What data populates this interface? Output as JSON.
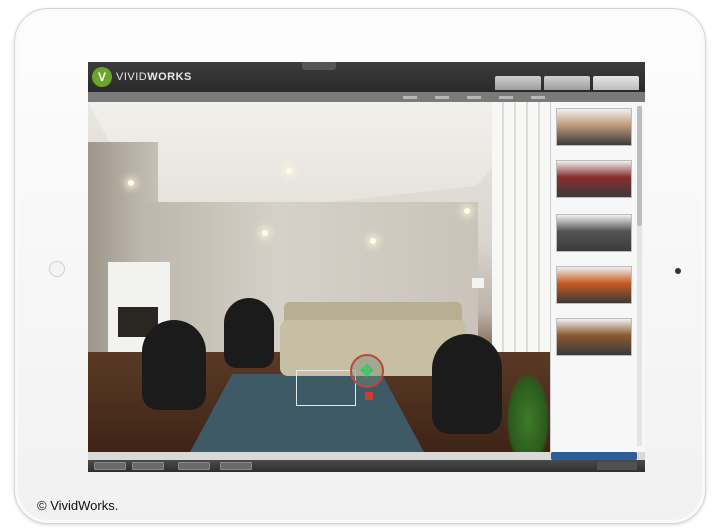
{
  "brand": {
    "logo_mark": "V",
    "logo_text_light": "VIVID",
    "logo_text_bold": "WORKS",
    "accent": "#6aa62a"
  },
  "header": {
    "top_tabs": [
      "",
      "",
      ""
    ],
    "category_tabs": [
      "",
      "",
      "",
      "",
      ""
    ]
  },
  "catalog": {
    "items": [
      {
        "label": "",
        "thumb_color": "#c09a7a"
      },
      {
        "label": "",
        "thumb_color": "#8a2d2d"
      },
      {
        "label": "",
        "thumb_color": "#555555"
      },
      {
        "label": "",
        "thumb_color": "#c85a20"
      },
      {
        "label": "",
        "thumb_color": "#8a5a30"
      }
    ]
  },
  "room": {
    "move_control_icon": "move-arrows-icon",
    "delete_control_icon": "delete-icon"
  },
  "status": {
    "hint": ""
  },
  "toolbar": {
    "buttons": [
      "",
      "",
      "",
      ""
    ]
  },
  "footer": {
    "copyright": "© VividWorks."
  }
}
